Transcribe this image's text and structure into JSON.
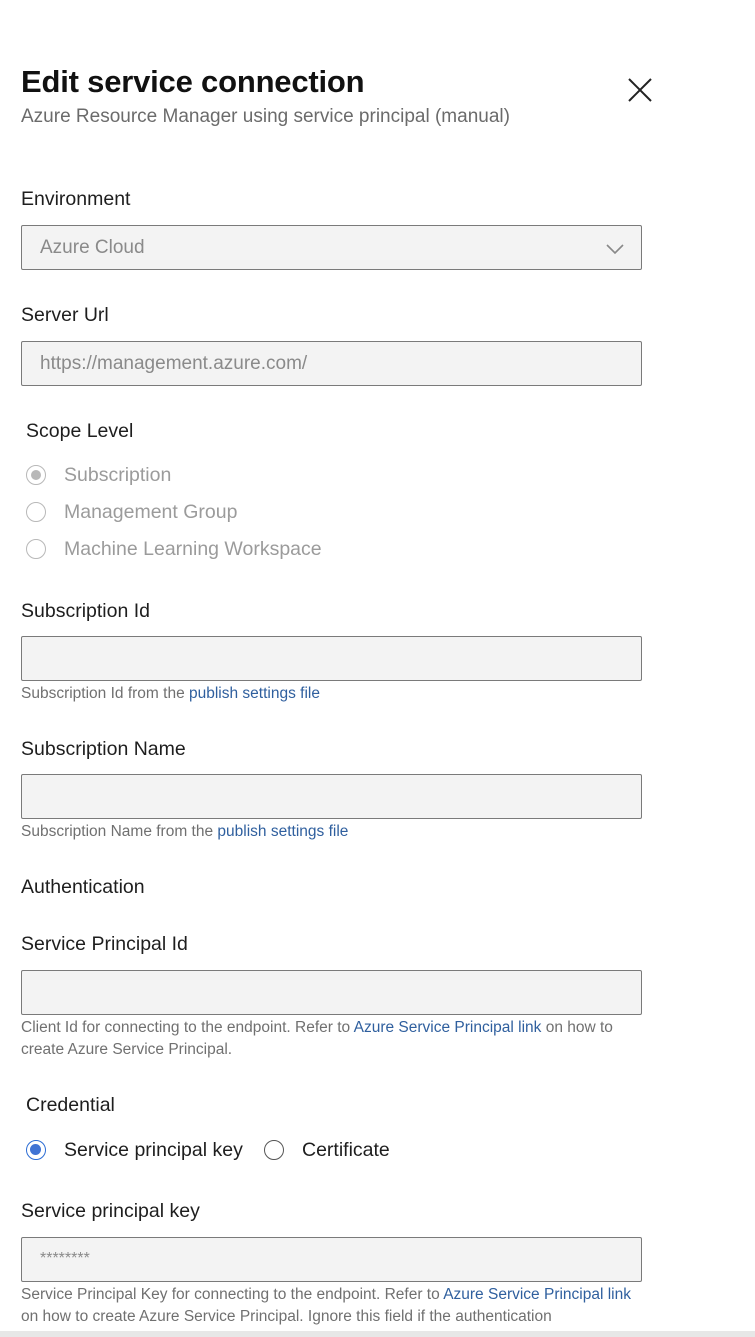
{
  "header": {
    "title": "Edit service connection",
    "subtitle": "Azure Resource Manager using service principal (manual)",
    "close_icon": "close-icon"
  },
  "environment": {
    "label": "Environment",
    "value": "Azure Cloud",
    "icon": "chevron-down-icon"
  },
  "server_url": {
    "label": "Server Url",
    "value": "https://management.azure.com/"
  },
  "scope_level": {
    "label": "Scope Level",
    "options": [
      {
        "label": "Subscription",
        "selected": true
      },
      {
        "label": "Management Group",
        "selected": false
      },
      {
        "label": "Machine Learning Workspace",
        "selected": false
      }
    ]
  },
  "subscription_id": {
    "label": "Subscription Id",
    "value": "",
    "help_prefix": "Subscription Id from the ",
    "help_link": "publish settings file"
  },
  "subscription_name": {
    "label": "Subscription Name",
    "value": "",
    "help_prefix": "Subscription Name from the ",
    "help_link": "publish settings file"
  },
  "authentication": {
    "label": "Authentication"
  },
  "service_principal_id": {
    "label": "Service Principal Id",
    "value": "",
    "help_prefix": "Client Id for connecting to the endpoint. Refer to ",
    "help_link": "Azure Service Principal link",
    "help_suffix": " on how to create Azure Service Principal."
  },
  "credential": {
    "label": "Credential",
    "options": [
      {
        "label": "Service principal key",
        "selected": true
      },
      {
        "label": "Certificate",
        "selected": false
      }
    ]
  },
  "service_principal_key": {
    "label": "Service principal key",
    "value": "********",
    "help_prefix": "Service Principal Key for connecting to the endpoint. Refer to ",
    "help_link": "Azure Service Principal link",
    "help_suffix": " on how to create Azure Service Principal. Ignore this field if the authentication"
  },
  "colors": {
    "accent": "#3f73d4",
    "link": "#2f5f9e",
    "field_bg": "#f3f3f3"
  }
}
